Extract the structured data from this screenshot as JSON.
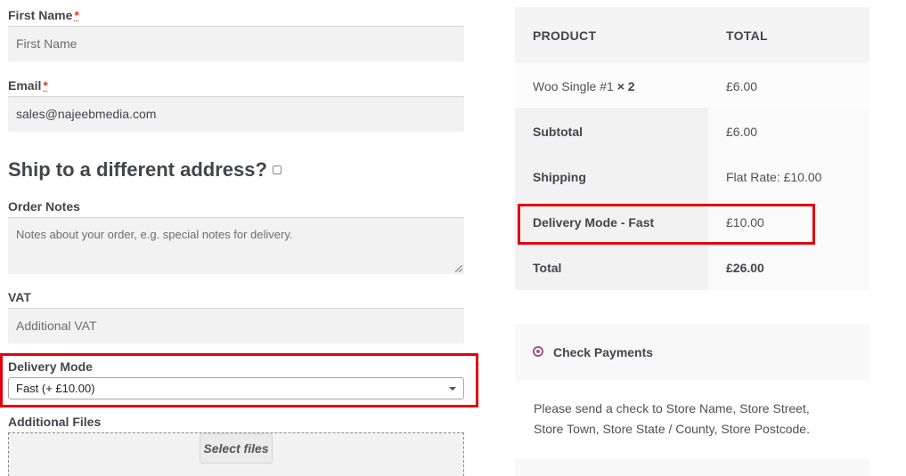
{
  "form": {
    "first_name": {
      "label": "First Name",
      "required_mark": "*",
      "placeholder": "First Name"
    },
    "email": {
      "label": "Email",
      "required_mark": "*",
      "value": "sales@najeebmedia.com"
    },
    "ship_different": {
      "heading": "Ship to a different address?",
      "checked": false
    },
    "order_notes": {
      "label": "Order Notes",
      "placeholder": "Notes about your order, e.g. special notes for delivery."
    },
    "vat": {
      "label": "VAT",
      "placeholder": "Additional VAT"
    },
    "delivery_mode": {
      "label": "Delivery Mode",
      "selected": "Fast (+ £10.00)"
    },
    "additional_files": {
      "label": "Additional Files",
      "button": "Select files"
    }
  },
  "order": {
    "headers": {
      "product": "PRODUCT",
      "total": "TOTAL"
    },
    "item": {
      "name": "Woo Single #1",
      "qty": "× 2",
      "total": "£6.00"
    },
    "subtotal": {
      "label": "Subtotal",
      "value": "£6.00"
    },
    "shipping": {
      "label": "Shipping",
      "value": "Flat Rate: £10.00"
    },
    "delivery_fee": {
      "label": "Delivery Mode - Fast",
      "value": "£10.00"
    },
    "total": {
      "label": "Total",
      "value": "£26.00"
    }
  },
  "payment": {
    "method": "Check Payments",
    "description": "Please send a check to Store Name, Store Street, Store Town, Store State / County, Store Postcode."
  },
  "colors": {
    "highlight": "#e3000f",
    "accent": "#96588a",
    "required": "#e2401c"
  }
}
